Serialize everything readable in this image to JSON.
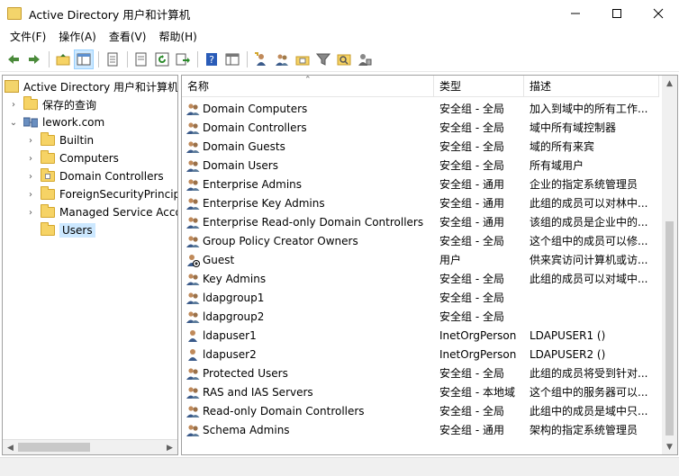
{
  "window": {
    "title": "Active Directory 用户和计算机"
  },
  "menu": [
    "文件(F)",
    "操作(A)",
    "查看(V)",
    "帮助(H)"
  ],
  "toolbar_icons": [
    "back-icon",
    "forward-icon",
    "up-folder-icon",
    "show-tree-icon",
    "properties-icon",
    "export-list-icon",
    "refresh-icon",
    "export-icon",
    "help-icon",
    "mmc-icon",
    "add-user-icon",
    "add-group-icon",
    "add-ou-icon",
    "filter-icon",
    "find-icon",
    "delegate-icon"
  ],
  "tree": [
    {
      "label": "Active Directory 用户和计算机",
      "level": 0,
      "arrow": "",
      "icon": "ad"
    },
    {
      "label": "保存的查询",
      "level": 1,
      "arrow": ">",
      "icon": "folder"
    },
    {
      "label": "lework.com",
      "level": 1,
      "arrow": "v",
      "icon": "domain"
    },
    {
      "label": "Builtin",
      "level": 2,
      "arrow": ">",
      "icon": "folder"
    },
    {
      "label": "Computers",
      "level": 2,
      "arrow": ">",
      "icon": "folder"
    },
    {
      "label": "Domain Controllers",
      "level": 2,
      "arrow": ">",
      "icon": "folder-ou"
    },
    {
      "label": "ForeignSecurityPrincipals",
      "level": 2,
      "arrow": ">",
      "icon": "folder"
    },
    {
      "label": "Managed Service Accounts",
      "level": 2,
      "arrow": ">",
      "icon": "folder"
    },
    {
      "label": "Users",
      "level": 2,
      "arrow": "",
      "icon": "folder",
      "selected": true
    }
  ],
  "columns": {
    "name": "名称",
    "type": "类型",
    "desc": "描述"
  },
  "rows": [
    {
      "name": "Domain Computers",
      "type": "安全组 - 全局",
      "desc": "加入到域中的所有工作...",
      "icon": "group"
    },
    {
      "name": "Domain Controllers",
      "type": "安全组 - 全局",
      "desc": "域中所有域控制器",
      "icon": "group"
    },
    {
      "name": "Domain Guests",
      "type": "安全组 - 全局",
      "desc": "域的所有来宾",
      "icon": "group"
    },
    {
      "name": "Domain Users",
      "type": "安全组 - 全局",
      "desc": "所有域用户",
      "icon": "group"
    },
    {
      "name": "Enterprise Admins",
      "type": "安全组 - 通用",
      "desc": "企业的指定系统管理员",
      "icon": "group"
    },
    {
      "name": "Enterprise Key Admins",
      "type": "安全组 - 通用",
      "desc": "此组的成员可以对林中...",
      "icon": "group"
    },
    {
      "name": "Enterprise Read-only Domain Controllers",
      "type": "安全组 - 通用",
      "desc": "该组的成员是企业中的...",
      "icon": "group"
    },
    {
      "name": "Group Policy Creator Owners",
      "type": "安全组 - 全局",
      "desc": "这个组中的成员可以修...",
      "icon": "group"
    },
    {
      "name": "Guest",
      "type": "用户",
      "desc": "供来宾访问计算机或访...",
      "icon": "user-disabled"
    },
    {
      "name": "Key Admins",
      "type": "安全组 - 全局",
      "desc": "此组的成员可以对域中...",
      "icon": "group"
    },
    {
      "name": "ldapgroup1",
      "type": "安全组 - 全局",
      "desc": "",
      "icon": "group"
    },
    {
      "name": "ldapgroup2",
      "type": "安全组 - 全局",
      "desc": "",
      "icon": "group"
    },
    {
      "name": "ldapuser1",
      "type": "InetOrgPerson",
      "desc": "LDAPUSER1 ()",
      "icon": "user"
    },
    {
      "name": "ldapuser2",
      "type": "InetOrgPerson",
      "desc": "LDAPUSER2 ()",
      "icon": "user"
    },
    {
      "name": "Protected Users",
      "type": "安全组 - 全局",
      "desc": "此组的成员将受到针对...",
      "icon": "group"
    },
    {
      "name": "RAS and IAS Servers",
      "type": "安全组 - 本地域",
      "desc": "这个组中的服务器可以...",
      "icon": "group"
    },
    {
      "name": "Read-only Domain Controllers",
      "type": "安全组 - 全局",
      "desc": "此组中的成员是域中只...",
      "icon": "group"
    },
    {
      "name": "Schema Admins",
      "type": "安全组 - 通用",
      "desc": "架构的指定系统管理员",
      "icon": "group"
    }
  ]
}
